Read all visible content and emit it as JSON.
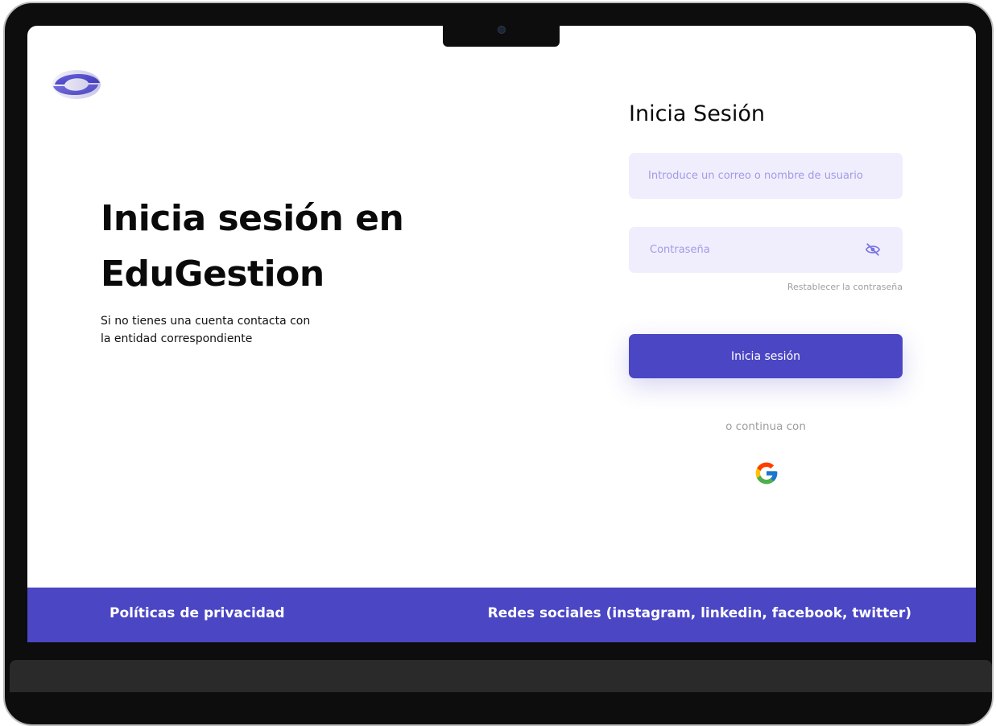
{
  "hero": {
    "title_line1": "Inicia sesión en",
    "title_line2": "EduGestion",
    "subtitle_line1": "Si no tienes una cuenta contacta con",
    "subtitle_line2": "la entidad correspondiente"
  },
  "form": {
    "title": "Inicia Sesión",
    "username_placeholder": "Introduce un correo o nombre de usuario",
    "password_placeholder": "Contraseña",
    "reset_link": "Restablecer la contraseña",
    "submit_label": "Inicia sesión",
    "or_continue": "o continua con"
  },
  "footer": {
    "privacy": "Políticas de privacidad",
    "social": "Redes sociales (instagram, linkedin, facebook, twitter)"
  },
  "colors": {
    "accent": "#4b46c4",
    "field_bg": "#f0eefd",
    "placeholder": "#a09be6"
  },
  "icons": {
    "logo": "brand-logo-icon",
    "password_toggle": "eye-off-icon",
    "google": "google-icon"
  }
}
